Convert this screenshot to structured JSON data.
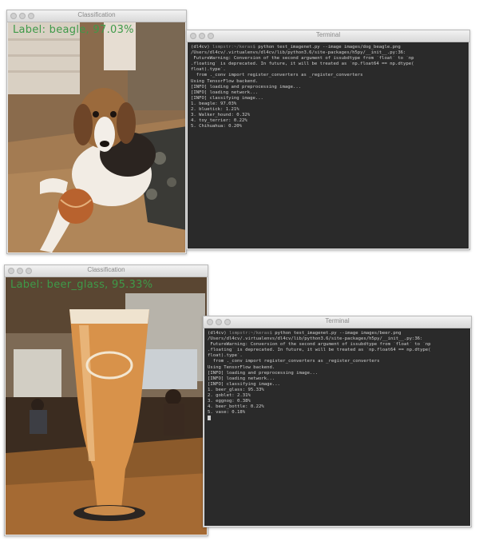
{
  "top": {
    "classification": {
      "title": "Classification",
      "overlay_text": "Label: beagle, 97.03%"
    },
    "terminal": {
      "title": "Terminal",
      "prompt_env": "(dl4cv)",
      "prompt_user": "lsmpstr:~/keras$",
      "command": "python test_imagenet.py --image images/dog_beagle.png",
      "output_lines": [
        "/Users/dl4cv/.virtualenvs/dl4cv/lib/python3.6/site-packages/h5py/__init__.py:36:",
        " FutureWarning: Conversion of the second argument of issubdtype from `float` to `np",
        ".floating` is deprecated. In future, it will be treated as `np.float64 == np.dtype(",
        "float).type`.",
        "  from ._conv import register_converters as _register_converters",
        "Using TensorFlow backend.",
        "[INFO] loading and preprocessing image...",
        "[INFO] loading network...",
        "[INFO] classifying image...",
        "1. beagle: 97.03%",
        "2. bluetick: 1.21%",
        "3. Walker_hound: 0.32%",
        "4. toy_terrier: 0.22%",
        "5. Chihuahua: 0.20%"
      ]
    }
  },
  "bottom": {
    "classification": {
      "title": "Classification",
      "overlay_text": "Label: beer_glass, 95.33%"
    },
    "terminal": {
      "title": "Terminal",
      "prompt_env": "(dl4cv)",
      "prompt_user": "lsmpstr:~/keras$",
      "command": "python test_imagenet.py --image images/beer.png",
      "output_lines": [
        "/Users/dl4cv/.virtualenvs/dl4cv/lib/python3.6/site-packages/h5py/__init__.py:36:",
        " FutureWarning: Conversion of the second argument of issubdtype from `float` to `np",
        ".floating` is deprecated. In future, it will be treated as `np.float64 == np.dtype(",
        "float).type`.",
        "  from ._conv import register_converters as _register_converters",
        "Using TensorFlow backend.",
        "[INFO] loading and preprocessing image...",
        "[INFO] loading network...",
        "[INFO] classifying image...",
        "1. beer_glass: 95.33%",
        "2. goblet: 2.31%",
        "3. eggnog: 0.38%",
        "4. beer_bottle: 0.22%",
        "5. vase: 0.18%"
      ]
    }
  }
}
